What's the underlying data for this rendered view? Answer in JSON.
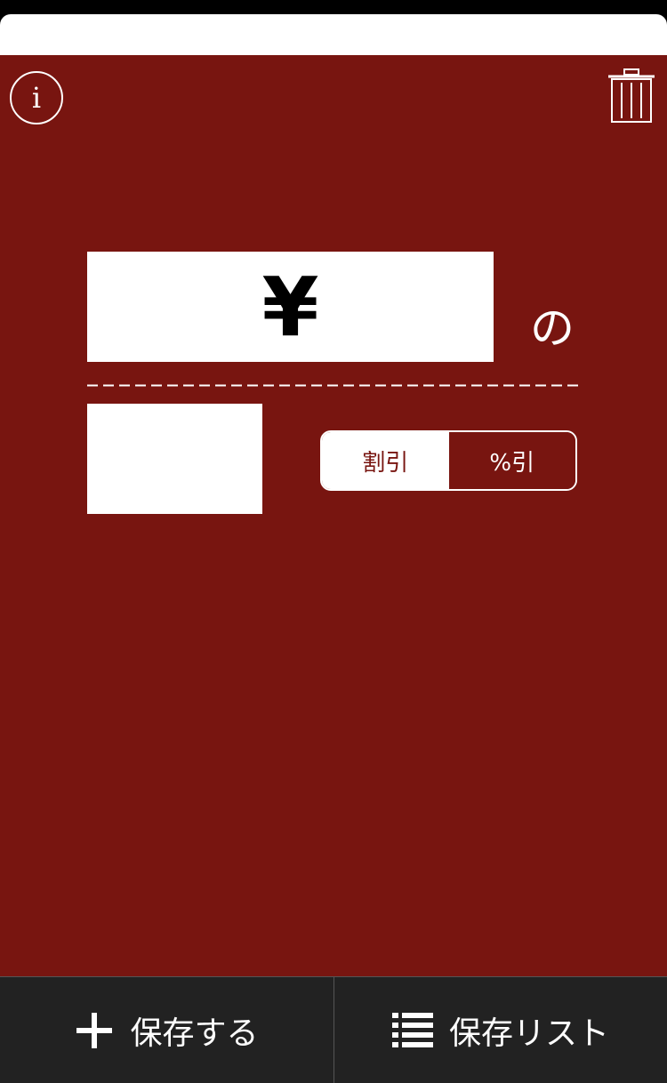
{
  "colors": {
    "main_background": "#781510",
    "bottom_bar": "#222222",
    "accent_white": "#ffffff"
  },
  "header": {
    "info_icon": "info-circle-icon",
    "info_glyph": "i",
    "trash_icon": "trash-icon"
  },
  "calculator": {
    "currency_symbol": "¥",
    "price_value": "",
    "of_label": "の",
    "discount_value": "",
    "mode_options": [
      "割引",
      "%引"
    ],
    "selected_mode": "割引"
  },
  "bottom_bar": {
    "save_icon": "plus-icon",
    "save_label": "保存する",
    "list_icon": "list-icon",
    "list_label": "保存リスト"
  }
}
